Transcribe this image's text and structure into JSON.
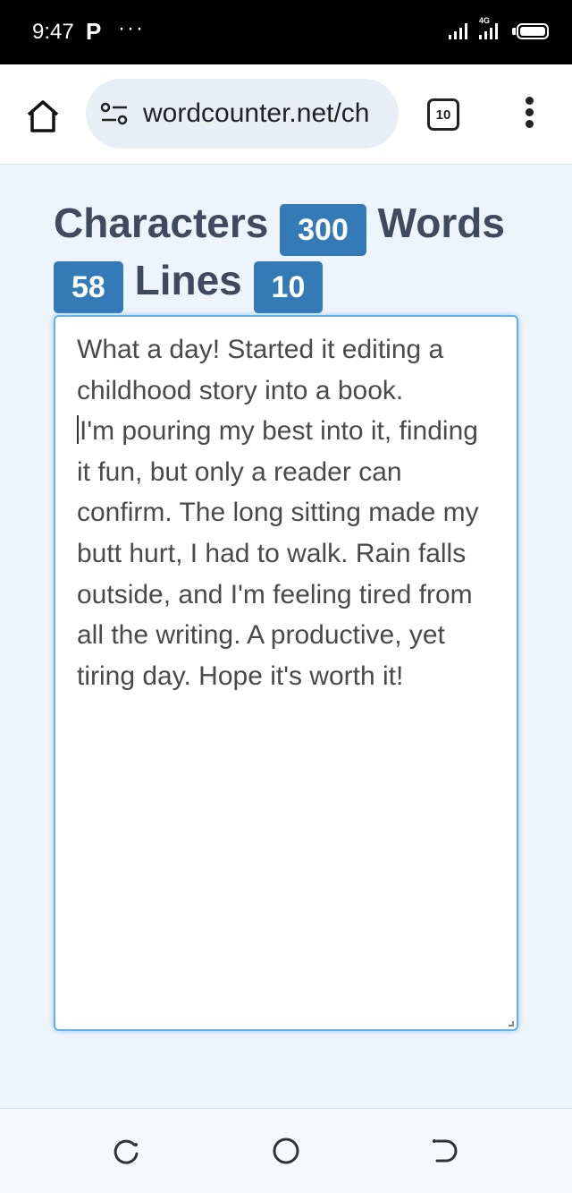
{
  "status_bar": {
    "time": "9:47",
    "app_indicator": "P",
    "more": "···",
    "network": "4G",
    "icons": [
      "signal-icon",
      "signal-4g-icon",
      "battery-icon"
    ]
  },
  "browser": {
    "url": "wordcounter.net/ch",
    "tab_count": "10",
    "icons": [
      "home-icon",
      "site-settings-icon",
      "tabs-icon",
      "more-vert-icon"
    ]
  },
  "counts": {
    "characters_label": "Characters",
    "characters_value": "300",
    "words_label": "Words",
    "words_value": "58",
    "lines_label": "Lines",
    "lines_value": "10"
  },
  "editor": {
    "line1": "What a day! Started it editing a childhood story into a book.",
    "line2": "I'm pouring my best into it, finding it fun, but only a reader can confirm. The long sitting made my butt hurt, I had to walk. Rain falls outside, and I'm feeling tired from all the writing. A productive, yet tiring day. Hope it's worth it!"
  },
  "nav_bar": {
    "icons": [
      "recents-icon",
      "home-circle-icon",
      "back-icon"
    ]
  },
  "colors": {
    "badge": "#337ab7",
    "heading_text": "#3f4a5e",
    "editor_border": "#66afe9",
    "page_bg": "#eef4fb"
  }
}
